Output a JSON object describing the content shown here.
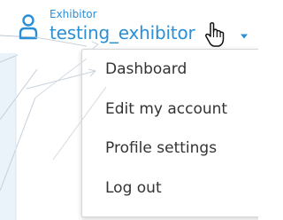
{
  "user": {
    "role": "Exhibitor",
    "username": "testing_exhibitor",
    "icon": "user-icon"
  },
  "cursor": {
    "icon": "hand-pointer-icon"
  },
  "menu": {
    "toggle_icon": "caret-down-icon",
    "items": [
      {
        "label": "Dashboard"
      },
      {
        "label": "Edit my account"
      },
      {
        "label": "Profile settings"
      },
      {
        "label": "Log out"
      }
    ]
  },
  "colors": {
    "accent": "#2b8fd6",
    "text": "#333333",
    "border": "#d6d6d6"
  }
}
